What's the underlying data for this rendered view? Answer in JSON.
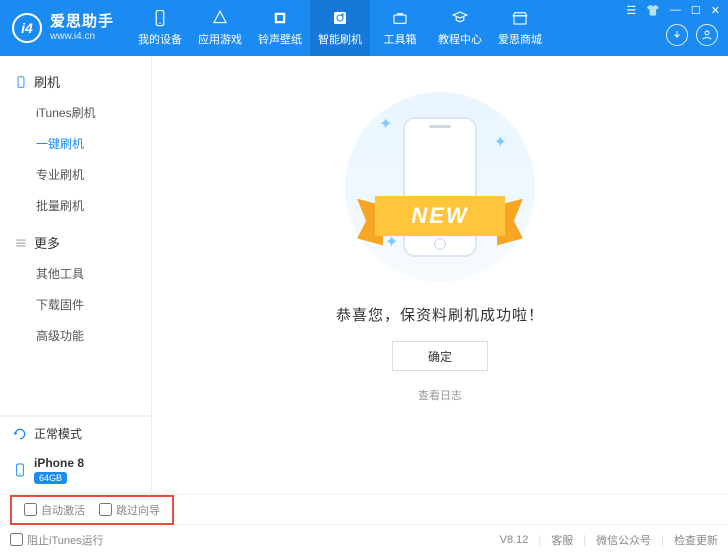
{
  "brand": {
    "title": "爱思助手",
    "url": "www.i4.cn",
    "logo": "i4"
  },
  "nav": [
    {
      "label": "我的设备",
      "icon": "device"
    },
    {
      "label": "应用游戏",
      "icon": "apps"
    },
    {
      "label": "铃声壁纸",
      "icon": "ringtone"
    },
    {
      "label": "智能刷机",
      "icon": "flash",
      "active": true
    },
    {
      "label": "工具箱",
      "icon": "tools"
    },
    {
      "label": "教程中心",
      "icon": "tutorial"
    },
    {
      "label": "爱思商城",
      "icon": "store"
    }
  ],
  "sidebar": {
    "group1": {
      "title": "刷机",
      "items": [
        "iTunes刷机",
        "一键刷机",
        "专业刷机",
        "批量刷机"
      ],
      "selected": 1
    },
    "group2": {
      "title": "更多",
      "items": [
        "其他工具",
        "下载固件",
        "高级功能"
      ]
    },
    "mode": "正常模式",
    "device": {
      "name": "iPhone 8",
      "capacity": "64GB"
    }
  },
  "content": {
    "ribbon": "NEW",
    "message": "恭喜您，保资料刷机成功啦！",
    "ok": "确定",
    "loglink": "查看日志"
  },
  "options": {
    "auto": "自动激活",
    "skip": "跳过向导"
  },
  "statusbar": {
    "block": "阻止iTunes运行",
    "version": "V8.12",
    "kf": "客服",
    "wx": "微信公众号",
    "update": "检查更新"
  }
}
